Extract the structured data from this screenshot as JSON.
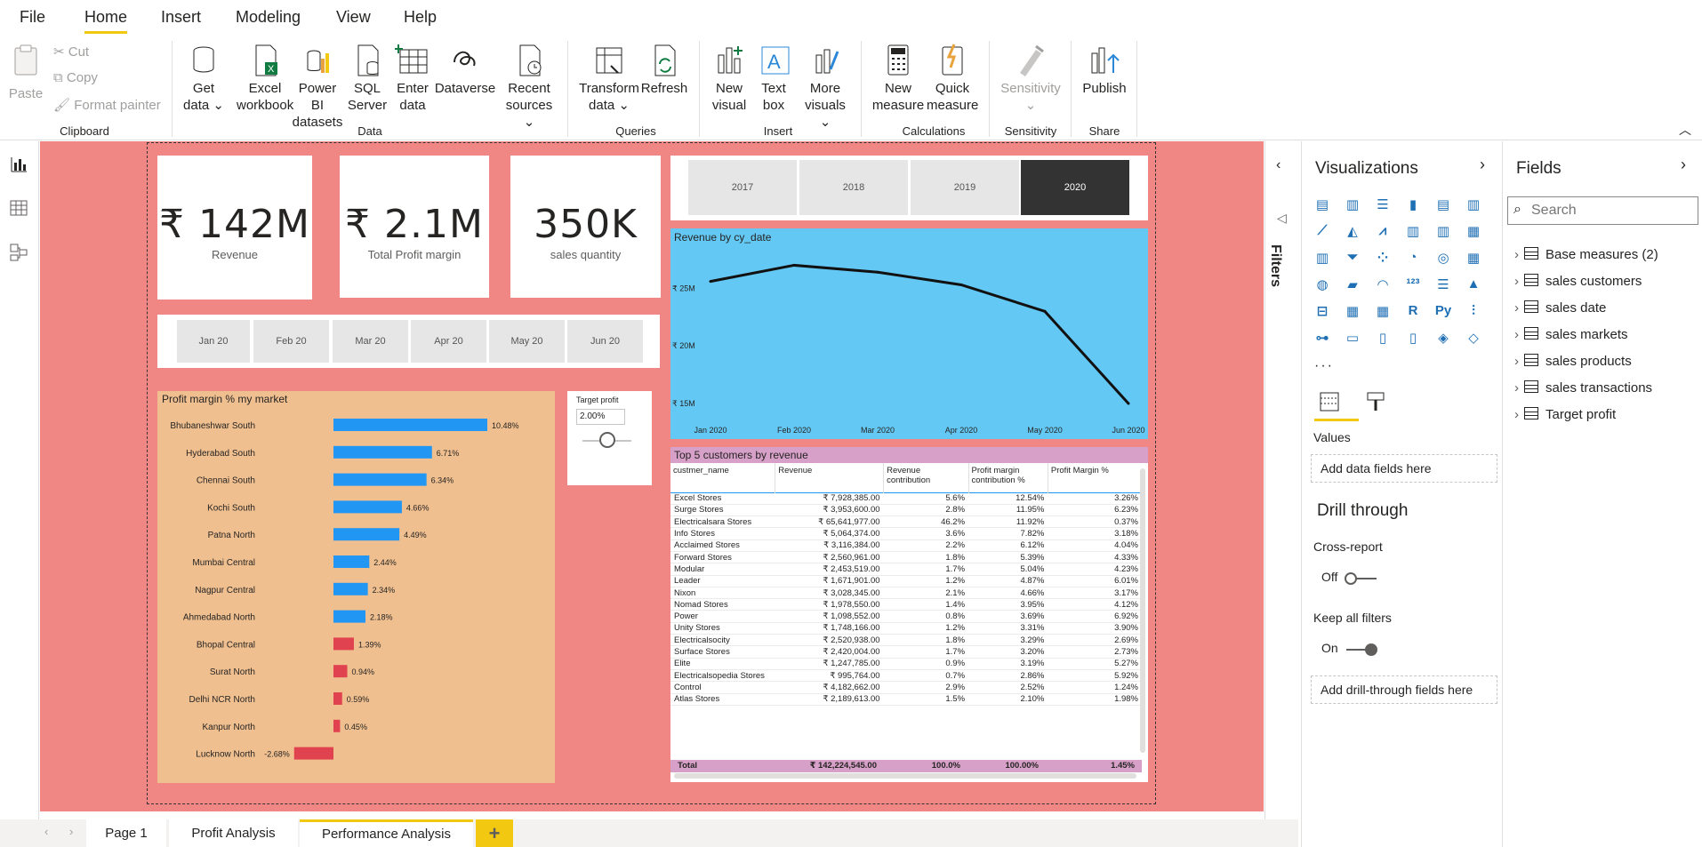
{
  "menu": {
    "file": "File",
    "home": "Home",
    "insert": "Insert",
    "modeling": "Modeling",
    "view": "View",
    "help": "Help"
  },
  "ribbon": {
    "paste": "Paste",
    "cut": "Cut",
    "copy": "Copy",
    "format_painter": "Format painter",
    "clipboard": "Clipboard",
    "get_data_1": "Get",
    "get_data_2": "data ⌄",
    "excel_1": "Excel",
    "excel_2": "workbook",
    "pbi_1": "Power BI",
    "pbi_2": "datasets",
    "sql_1": "SQL",
    "sql_2": "Server",
    "enter_1": "Enter",
    "enter_2": "data",
    "dataverse": "Dataverse",
    "recent_1": "Recent",
    "recent_2": "sources ⌄",
    "data_group": "Data",
    "transform_1": "Transform",
    "transform_2": "data ⌄",
    "refresh": "Refresh",
    "queries_group": "Queries",
    "newvis_1": "New",
    "newvis_2": "visual",
    "textbox_1": "Text",
    "textbox_2": "box",
    "more_1": "More",
    "more_2": "visuals ⌄",
    "insert_group": "Insert",
    "newmeasure_1": "New",
    "newmeasure_2": "measure",
    "quick_1": "Quick",
    "quick_2": "measure",
    "calc_group": "Calculations",
    "sensitivity": "Sensitivity",
    "sens_caret": "⌄",
    "sens_group": "Sensitivity",
    "publish": "Publish",
    "share_group": "Share"
  },
  "kpis": [
    {
      "value": "₹ 142M",
      "label": "Revenue"
    },
    {
      "value": "₹ 2.1M",
      "label": "Total Profit margin"
    },
    {
      "value": "350K",
      "label": "sales quantity"
    }
  ],
  "month_slicer": [
    "Jan 20",
    "Feb 20",
    "Mar 20",
    "Apr 20",
    "May 20",
    "Jun 20"
  ],
  "year_slicer": {
    "years": [
      "2017",
      "2018",
      "2019",
      "2020"
    ],
    "selected": "2020"
  },
  "target_profit": {
    "title": "Target profit",
    "value": "2.00%",
    "slider_fraction": 0.5
  },
  "colors": {
    "canvas": "#f08784",
    "card_orange": "#f0bf8f",
    "line_bg": "#64c8f5",
    "bar_pos": "#2196f3",
    "bar_neg": "#e0434f",
    "table_header": "#d7a0c8",
    "tab_accent": "#f2c811"
  },
  "chart_data": [
    {
      "type": "bar",
      "title": "Profit margin % my market",
      "categories": [
        "Bhubaneshwar South",
        "Hyderabad South",
        "Chennai South",
        "Kochi South",
        "Patna North",
        "Mumbai Central",
        "Nagpur Central",
        "Ahmedabad North",
        "Bhopal Central",
        "Surat North",
        "Delhi NCR North",
        "Kanpur North",
        "Lucknow North"
      ],
      "values": [
        10.48,
        6.71,
        6.34,
        4.66,
        4.49,
        2.44,
        2.34,
        2.18,
        1.39,
        0.94,
        0.59,
        0.45,
        -2.68
      ],
      "labels": [
        "10.48%",
        "6.71%",
        "6.34%",
        "4.66%",
        "4.49%",
        "2.44%",
        "2.34%",
        "2.18%",
        "1.39%",
        "0.94%",
        "0.59%",
        "0.45%",
        "-2.68%"
      ]
    },
    {
      "type": "line",
      "title": "Revenue by cy_date",
      "x": [
        "Jan 2020",
        "Feb 2020",
        "Mar 2020",
        "Apr 2020",
        "May 2020",
        "Jun 2020"
      ],
      "values": [
        25.6,
        27.0,
        26.4,
        25.3,
        23.0,
        15.0
      ],
      "yticks": [
        "₹ 25M",
        "₹ 20M",
        "₹ 15M"
      ],
      "ytick_values": [
        25,
        20,
        15
      ],
      "ylim": [
        14,
        28.5
      ],
      "grid": false
    }
  ],
  "table": {
    "title": "Top 5 customers by revenue",
    "headers": [
      "custmer_name",
      "Revenue",
      "Revenue contribution",
      "Profit margin contribution %",
      "Profit Margin %"
    ],
    "rows": [
      [
        "Excel Stores",
        "₹ 7,928,385.00",
        "5.6%",
        "12.54%",
        "3.26%"
      ],
      [
        "Surge Stores",
        "₹ 3,953,600.00",
        "2.8%",
        "11.95%",
        "6.23%"
      ],
      [
        "Electricalsara Stores",
        "₹ 65,641,977.00",
        "46.2%",
        "11.92%",
        "0.37%"
      ],
      [
        "Info Stores",
        "₹ 5,064,374.00",
        "3.6%",
        "7.82%",
        "3.18%"
      ],
      [
        "Acclaimed Stores",
        "₹ 3,116,384.00",
        "2.2%",
        "6.12%",
        "4.04%"
      ],
      [
        "Forward Stores",
        "₹ 2,560,961.00",
        "1.8%",
        "5.39%",
        "4.33%"
      ],
      [
        "Modular",
        "₹ 2,453,519.00",
        "1.7%",
        "5.04%",
        "4.23%"
      ],
      [
        "Leader",
        "₹ 1,671,901.00",
        "1.2%",
        "4.87%",
        "6.01%"
      ],
      [
        "Nixon",
        "₹ 3,028,345.00",
        "2.1%",
        "4.66%",
        "3.17%"
      ],
      [
        "Nomad Stores",
        "₹ 1,978,550.00",
        "1.4%",
        "3.95%",
        "4.12%"
      ],
      [
        "Power",
        "₹ 1,098,552.00",
        "0.8%",
        "3.69%",
        "6.92%"
      ],
      [
        "Unity Stores",
        "₹ 1,748,166.00",
        "1.2%",
        "3.31%",
        "3.90%"
      ],
      [
        "Electricalsocity",
        "₹ 2,520,938.00",
        "1.8%",
        "3.29%",
        "2.69%"
      ],
      [
        "Surface Stores",
        "₹ 2,420,004.00",
        "1.7%",
        "3.20%",
        "2.73%"
      ],
      [
        "Elite",
        "₹ 1,247,785.00",
        "0.9%",
        "3.19%",
        "5.27%"
      ],
      [
        "Electricalsopedia Stores",
        "₹ 995,764.00",
        "0.7%",
        "2.86%",
        "5.92%"
      ],
      [
        "Control",
        "₹ 4,182,662.00",
        "2.9%",
        "2.52%",
        "1.24%"
      ],
      [
        "Atlas Stores",
        "₹ 2,189,613.00",
        "1.5%",
        "2.10%",
        "1.98%"
      ]
    ],
    "total": [
      "Total",
      "₹ 142,224,545.00",
      "100.0%",
      "100.00%",
      "1.45%"
    ]
  },
  "filters_label": "Filters",
  "visualizations": {
    "title": "Visualizations",
    "values_label": "Values",
    "add_data": "Add data fields here",
    "drill_title": "Drill through",
    "cross_report": "Cross-report",
    "cross_state": "Off",
    "keep_filters": "Keep all filters",
    "keep_state": "On",
    "add_drill": "Add drill-through fields here",
    "ellipsis": "···"
  },
  "fields": {
    "title": "Fields",
    "search_placeholder": "Search",
    "tables": [
      "Base measures (2)",
      "sales customers",
      "sales date",
      "sales markets",
      "sales products",
      "sales transactions",
      "Target profit"
    ]
  },
  "tabs": {
    "page1": "Page 1",
    "profit": "Profit Analysis",
    "performance": "Performance Analysis",
    "add": "+"
  }
}
